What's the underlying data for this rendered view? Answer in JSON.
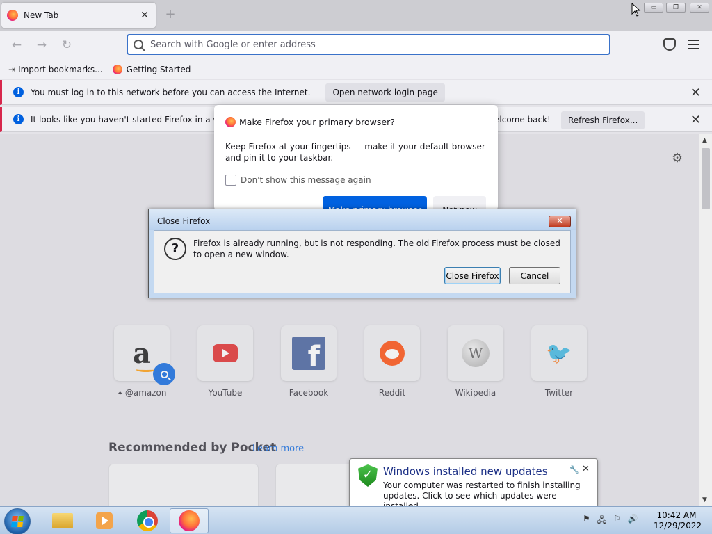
{
  "browser": {
    "tab": {
      "title": "New Tab",
      "close": "✕"
    },
    "new_tab": "+",
    "window_controls": {
      "minimize": "▭",
      "restore": "❐",
      "close": "✕"
    },
    "nav": {
      "back": "←",
      "forward": "→",
      "reload": "↻"
    },
    "urlbar": {
      "placeholder": "Search with Google or enter address",
      "value": ""
    },
    "bookmarks": [
      {
        "label": "Import bookmarks...",
        "icon": "import-icon"
      },
      {
        "label": "Getting Started",
        "icon": "firefox-icon"
      }
    ]
  },
  "infobars": [
    {
      "message": "You must log in to this network before you can access the Internet.",
      "button": "Open network login page",
      "close": "✕"
    },
    {
      "message": "It looks like you haven't started Firefox in a while. D",
      "fragment": "elcome back!",
      "button": "Refresh Firefox...",
      "close": "✕"
    }
  ],
  "new_tab_page": {
    "settings_icon": "⚙",
    "shortcuts": [
      {
        "label": "@amazon",
        "logo": "a",
        "pin": "✦",
        "icon": "amazon-icon"
      },
      {
        "label": "YouTube",
        "icon": "youtube-icon"
      },
      {
        "label": "Facebook",
        "logo": "f",
        "icon": "facebook-icon"
      },
      {
        "label": "Reddit",
        "icon": "reddit-icon"
      },
      {
        "label": "Wikipedia",
        "logo": "W",
        "icon": "wikipedia-icon"
      },
      {
        "label": "Twitter",
        "logo": "🐦",
        "icon": "twitter-icon"
      }
    ],
    "pocket": {
      "title": "Recommended by Pocket",
      "learn_more": "Learn more"
    }
  },
  "primary_dialog": {
    "title": "Make Firefox your primary browser?",
    "body": "Keep Firefox at your fingertips — make it your default browser and pin it to your taskbar.",
    "checkbox_label": "Don't show this message again",
    "primary_button": "Make primary browser",
    "secondary_button": "Not now"
  },
  "close_dialog": {
    "title": "Close Firefox",
    "close_glyph": "✕",
    "icon": "?",
    "message": "Firefox is already running, but is not responding. The old Firefox process must be closed to open a new window.",
    "ok_button": "Close Firefox",
    "cancel_button": "Cancel"
  },
  "update_balloon": {
    "title": "Windows installed new updates",
    "body": "Your computer was restarted to finish installing updates. Click to see which updates were installed.",
    "shield": "✓",
    "close": "✕",
    "settings": "🔧"
  },
  "taskbar": {
    "clock_time": "10:42 AM",
    "clock_date": "12/29/2022",
    "tray_icons": [
      "⚑",
      "🖧",
      "⚐",
      "🔊"
    ]
  }
}
